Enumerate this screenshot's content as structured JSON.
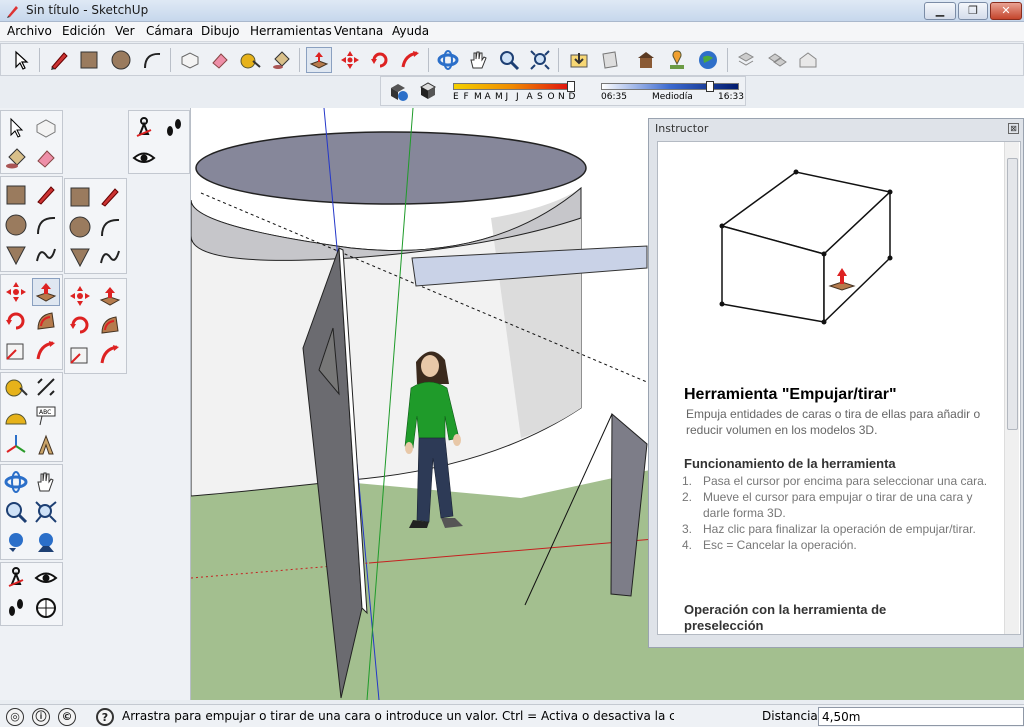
{
  "window": {
    "title": "Sin título - SketchUp",
    "minimize": "▁",
    "maximize": "❐",
    "close": "✕"
  },
  "menu": [
    "Archivo",
    "Edición",
    "Ver",
    "Cámara",
    "Dibujo",
    "Herramientas",
    "Ventana",
    "Ayuda"
  ],
  "shadows": {
    "months": [
      "E",
      "F",
      "M",
      "A",
      "M",
      "J",
      "J",
      "A",
      "S",
      "O",
      "N",
      "D"
    ],
    "time_start": "06:35",
    "time_mid": "Mediodía",
    "time_end": "16:33"
  },
  "instructor": {
    "panel_title": "Instructor",
    "close": "⊠",
    "heading": "Herramienta \"Empujar/tirar\"",
    "description": "Empuja entidades de caras o tira de ellas para añadir o reducir volumen en los modelos 3D.",
    "section1": "Funcionamiento de la herramienta",
    "steps": [
      {
        "n": "1.",
        "text": "Pasa el cursor por encima para seleccionar una cara."
      },
      {
        "n": "2.",
        "text": "Mueve el cursor para empujar o tirar de una cara y darle forma 3D."
      },
      {
        "n": "3.",
        "text": "Haz clic para finalizar la operación de empujar/tirar."
      },
      {
        "n": "4.",
        "text": "Esc = Cancelar la operación."
      }
    ],
    "section2": "Operación con la herramienta de preselección"
  },
  "status": {
    "message": "Arrastra para empujar o tirar de una cara o introduce un valor. Ctrl = Activa o desactiva la cre",
    "help_icon": "?",
    "measure_label": "Distancia",
    "measure_value": "4,50m"
  },
  "colors": {
    "ground": "#a3bf8f",
    "sky": "#ffffff",
    "accent_red": "#c62020",
    "figure_shirt": "#1f9b2a"
  }
}
